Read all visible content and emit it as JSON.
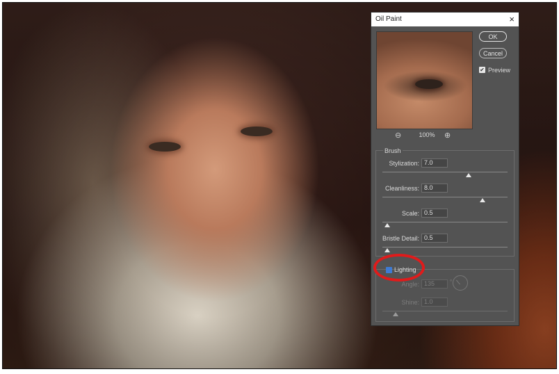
{
  "dialog": {
    "title": "Oil Paint",
    "close_icon": "close-icon",
    "ok_label": "OK",
    "cancel_label": "Cancel",
    "preview_label": "Preview",
    "preview_checked": true,
    "zoom_level": "100%"
  },
  "brush": {
    "legend": "Brush",
    "stylization": {
      "label": "Stylization:",
      "value": "7.0",
      "slider_fraction": 0.7
    },
    "cleanliness": {
      "label": "Cleanliness:",
      "value": "8.0",
      "slider_fraction": 0.8
    },
    "scale": {
      "label": "Scale:",
      "value": "0.5",
      "slider_fraction": 0.0
    },
    "bristle_detail": {
      "label": "Bristle Detail:",
      "value": "0.5",
      "slider_fraction": 0.0
    }
  },
  "lighting": {
    "label": "Lighting",
    "checked": false,
    "angle": {
      "label": "Angle:",
      "value": "135",
      "unit": "°"
    },
    "shine": {
      "label": "Shine:",
      "value": "1.0",
      "slider_fraction": 0.1
    }
  },
  "colors": {
    "dialog_bg": "#535353",
    "highlight_ring": "#e01b1b",
    "checkbox_active": "#3e7bd4"
  }
}
